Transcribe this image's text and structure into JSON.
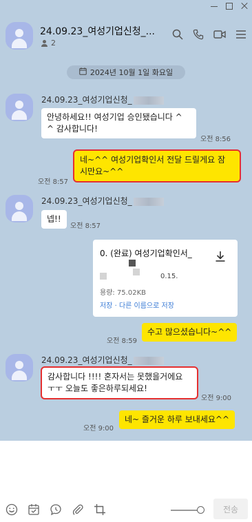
{
  "header": {
    "title": "24.09.23_여성기업신청_...",
    "member_count": "2"
  },
  "date_divider": "2024년 10월 1일 화요일",
  "messages": [
    {
      "sender": "24.09.23_여성기업신청_",
      "text_line1": "안녕하세요!! 여성기업 승인됐습니다 ^",
      "text_line2": "^ 감사합니다!",
      "time": "오전 8:56"
    },
    {
      "text_line1": "네~^^ 여성기업확인서 전달 드릴게요 잠",
      "text_line2": "시만요~^^",
      "time": "오전 8:57"
    },
    {
      "sender": "24.09.23_여성기업신청_",
      "text": "넵!!",
      "time": "오전 8:57"
    },
    {
      "file_name": "0. (완료) 여성기업확인서_",
      "file_ext": "0.15.",
      "file_size": "용량: 75.02KB",
      "save_label": "저장",
      "save_as_label": "다른 이름으로 저장"
    },
    {
      "text": "수고 많으셨습니다~^^",
      "time": "오전 8:59"
    },
    {
      "sender": "24.09.23_여성기업신청_",
      "text_line1": "감사합니다 !!!! 혼자서는 못했을거에요",
      "text_line2": "ㅜㅜ 오늘도 좋은하루되세요!",
      "time": "오전 9:00"
    },
    {
      "text": "네~ 즐거운 하루 보내세요^^",
      "time": "오전 9:00"
    }
  ],
  "composer": {
    "send_label": "전송"
  },
  "icons": [
    "minimize-icon",
    "maximize-icon",
    "close-icon",
    "search-icon",
    "call-icon",
    "video-icon",
    "menu-icon",
    "calendar-icon",
    "download-icon",
    "emoji-icon",
    "schedule-icon",
    "chat-bubble-icon",
    "attach-icon",
    "capture-icon"
  ],
  "colors": {
    "background": "#bacee0",
    "my_bubble": "#fee500",
    "highlight_box": "#e53030",
    "link": "#3a7bd5"
  }
}
